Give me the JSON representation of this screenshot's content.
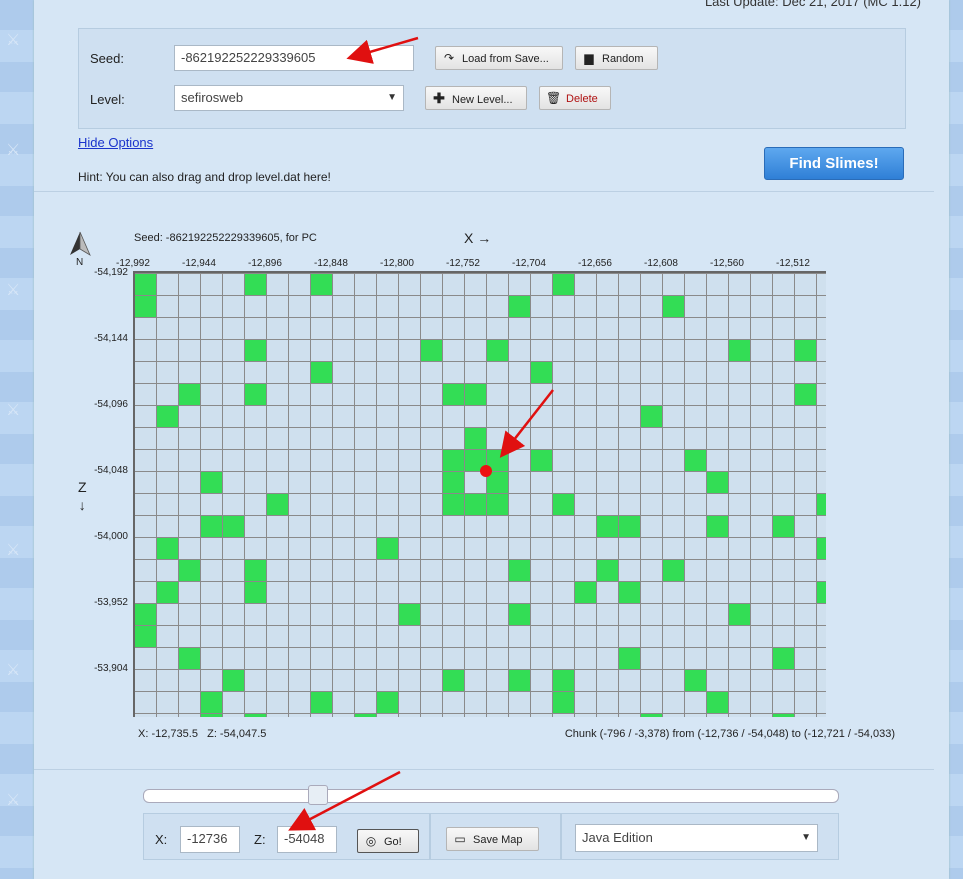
{
  "header": {
    "last_update": "Last Update: Dec 21, 2017 (MC 1.12)"
  },
  "options": {
    "seed_label": "Seed:",
    "seed_value": "-862192252229339605",
    "load_button": "Load from Save...",
    "random_button": "Random",
    "level_label": "Level:",
    "level_value": "sefirosweb",
    "new_level_button": "New Level...",
    "delete_button": "Delete"
  },
  "hide_options": "Hide Options",
  "hint": "Hint: You can also drag and drop level.dat here!",
  "find_button": "Find Slimes!",
  "map": {
    "compass_label": "N",
    "seed_info": "Seed: -862192252229339605, for PC",
    "x_axis": "X →",
    "z_axis_letter": "Z",
    "z_axis_arrow": "↓",
    "x_ticks": [
      "-12,992",
      "-12,944",
      "-12,896",
      "-12,848",
      "-12,800",
      "-12,752",
      "-12,704",
      "-12,656",
      "-12,608",
      "-12,560",
      "-12,512"
    ],
    "z_ticks": [
      "-54,192",
      "-54,144",
      "-54,096",
      "-54,048",
      "-54,000",
      "-53,952",
      "-53,904"
    ],
    "cursor_coords": "X: -12,735.5   Z: -54,047.5",
    "chunk_info": "Chunk (-796 / -3,378) from (-12,736 / -54,048) to (-12,721 / -54,033)",
    "slime_color": "#33dd55",
    "slime_chunks": [
      [
        0,
        0
      ],
      [
        5,
        0
      ],
      [
        8,
        0
      ],
      [
        19,
        0
      ],
      [
        0,
        1
      ],
      [
        17,
        1
      ],
      [
        24,
        1
      ],
      [
        5,
        3
      ],
      [
        13,
        3
      ],
      [
        16,
        3
      ],
      [
        27,
        3
      ],
      [
        30,
        3
      ],
      [
        8,
        4
      ],
      [
        18,
        4
      ],
      [
        2,
        5
      ],
      [
        5,
        5
      ],
      [
        14,
        5
      ],
      [
        15,
        5
      ],
      [
        30,
        5
      ],
      [
        1,
        6
      ],
      [
        23,
        6
      ],
      [
        15,
        7
      ],
      [
        14,
        8
      ],
      [
        15,
        8
      ],
      [
        16,
        8
      ],
      [
        18,
        8
      ],
      [
        25,
        8
      ],
      [
        3,
        9
      ],
      [
        14,
        9
      ],
      [
        16,
        9
      ],
      [
        26,
        9
      ],
      [
        6,
        10
      ],
      [
        14,
        10
      ],
      [
        15,
        10
      ],
      [
        16,
        10
      ],
      [
        19,
        10
      ],
      [
        31,
        10
      ],
      [
        3,
        11
      ],
      [
        4,
        11
      ],
      [
        21,
        11
      ],
      [
        22,
        11
      ],
      [
        26,
        11
      ],
      [
        29,
        11
      ],
      [
        1,
        12
      ],
      [
        11,
        12
      ],
      [
        31,
        12
      ],
      [
        2,
        13
      ],
      [
        5,
        13
      ],
      [
        17,
        13
      ],
      [
        21,
        13
      ],
      [
        24,
        13
      ],
      [
        1,
        14
      ],
      [
        5,
        14
      ],
      [
        20,
        14
      ],
      [
        22,
        14
      ],
      [
        31,
        14
      ],
      [
        0,
        15
      ],
      [
        12,
        15
      ],
      [
        17,
        15
      ],
      [
        27,
        15
      ],
      [
        0,
        16
      ],
      [
        2,
        17
      ],
      [
        22,
        17
      ],
      [
        29,
        17
      ],
      [
        4,
        18
      ],
      [
        14,
        18
      ],
      [
        17,
        18
      ],
      [
        19,
        18
      ],
      [
        25,
        18
      ],
      [
        3,
        19
      ],
      [
        8,
        19
      ],
      [
        11,
        19
      ],
      [
        19,
        19
      ],
      [
        26,
        19
      ],
      [
        3,
        20
      ],
      [
        5,
        20
      ],
      [
        10,
        20
      ],
      [
        23,
        20
      ],
      [
        29,
        20
      ]
    ]
  },
  "controls": {
    "x_label": "X:",
    "x_value": "-12736",
    "z_label": "Z:",
    "z_value": "-54048",
    "go_button": "Go!",
    "save_map_button": "Save Map",
    "edition_value": "Java Edition"
  }
}
